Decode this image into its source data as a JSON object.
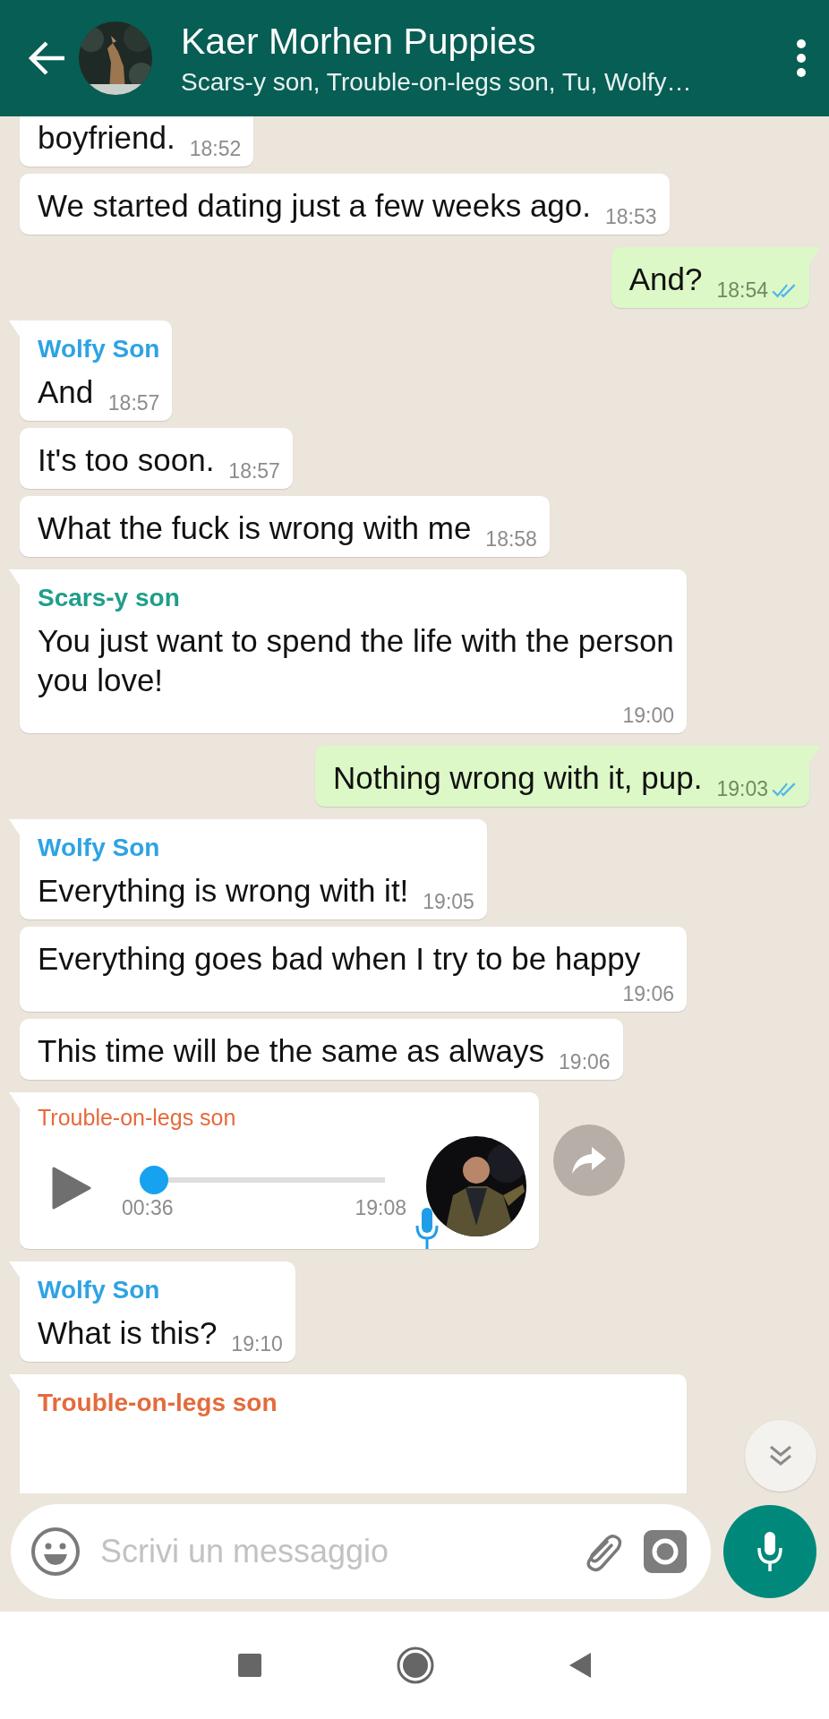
{
  "header": {
    "title": "Kaer Morhen Puppies",
    "subtitle": "Scars-y son, Trouble-on-legs son, Tu, Wolfy…"
  },
  "messages": [
    {
      "kind": "text",
      "outgoing": false,
      "tail": false,
      "text": "boyfriend.",
      "time": "18:52"
    },
    {
      "kind": "text",
      "outgoing": false,
      "tail": false,
      "text": "We started dating just a few weeks ago.",
      "time": "18:53"
    },
    {
      "kind": "text",
      "outgoing": true,
      "tail": true,
      "text": "And?",
      "time": "18:54",
      "read": true
    },
    {
      "kind": "text",
      "outgoing": false,
      "tail": true,
      "sender": "Wolfy Son",
      "color": "#2ea3e3",
      "text": "And",
      "time": "18:57"
    },
    {
      "kind": "text",
      "outgoing": false,
      "tail": false,
      "text": "It's too soon.",
      "time": "18:57"
    },
    {
      "kind": "text",
      "outgoing": false,
      "tail": false,
      "text": "What the fuck is wrong with me",
      "time": "18:58"
    },
    {
      "kind": "text",
      "outgoing": false,
      "tail": true,
      "sender": "Scars-y son",
      "color": "#1f9e8a",
      "text": "You just want to spend the life with the person you love!",
      "time": "19:00"
    },
    {
      "kind": "text",
      "outgoing": true,
      "tail": true,
      "text": "Nothing wrong with it, pup.",
      "time": "19:03",
      "read": true
    },
    {
      "kind": "text",
      "outgoing": false,
      "tail": true,
      "sender": "Wolfy Son",
      "color": "#2ea3e3",
      "text": "Everything is wrong with it!",
      "time": "19:05"
    },
    {
      "kind": "text",
      "outgoing": false,
      "tail": false,
      "text": "Everything goes bad when I try to be happy",
      "time": "19:06"
    },
    {
      "kind": "text",
      "outgoing": false,
      "tail": false,
      "text": "This time will be the same as always",
      "time": "19:06"
    },
    {
      "kind": "voice",
      "outgoing": false,
      "tail": true,
      "sender": "Trouble-on-legs son",
      "color": "#e56a3c",
      "level": 0,
      "duration": "00:36",
      "time": "19:08"
    },
    {
      "kind": "text",
      "outgoing": false,
      "tail": true,
      "sender": "Wolfy Son",
      "color": "#2ea3e3",
      "text": "What is this?",
      "time": "19:10"
    },
    {
      "kind": "text",
      "outgoing": false,
      "tail": true,
      "sender": "Trouble-on-legs son",
      "color": "#e56a3c"
    }
  ],
  "composer": {
    "placeholder": "Scrivi un messaggio"
  }
}
